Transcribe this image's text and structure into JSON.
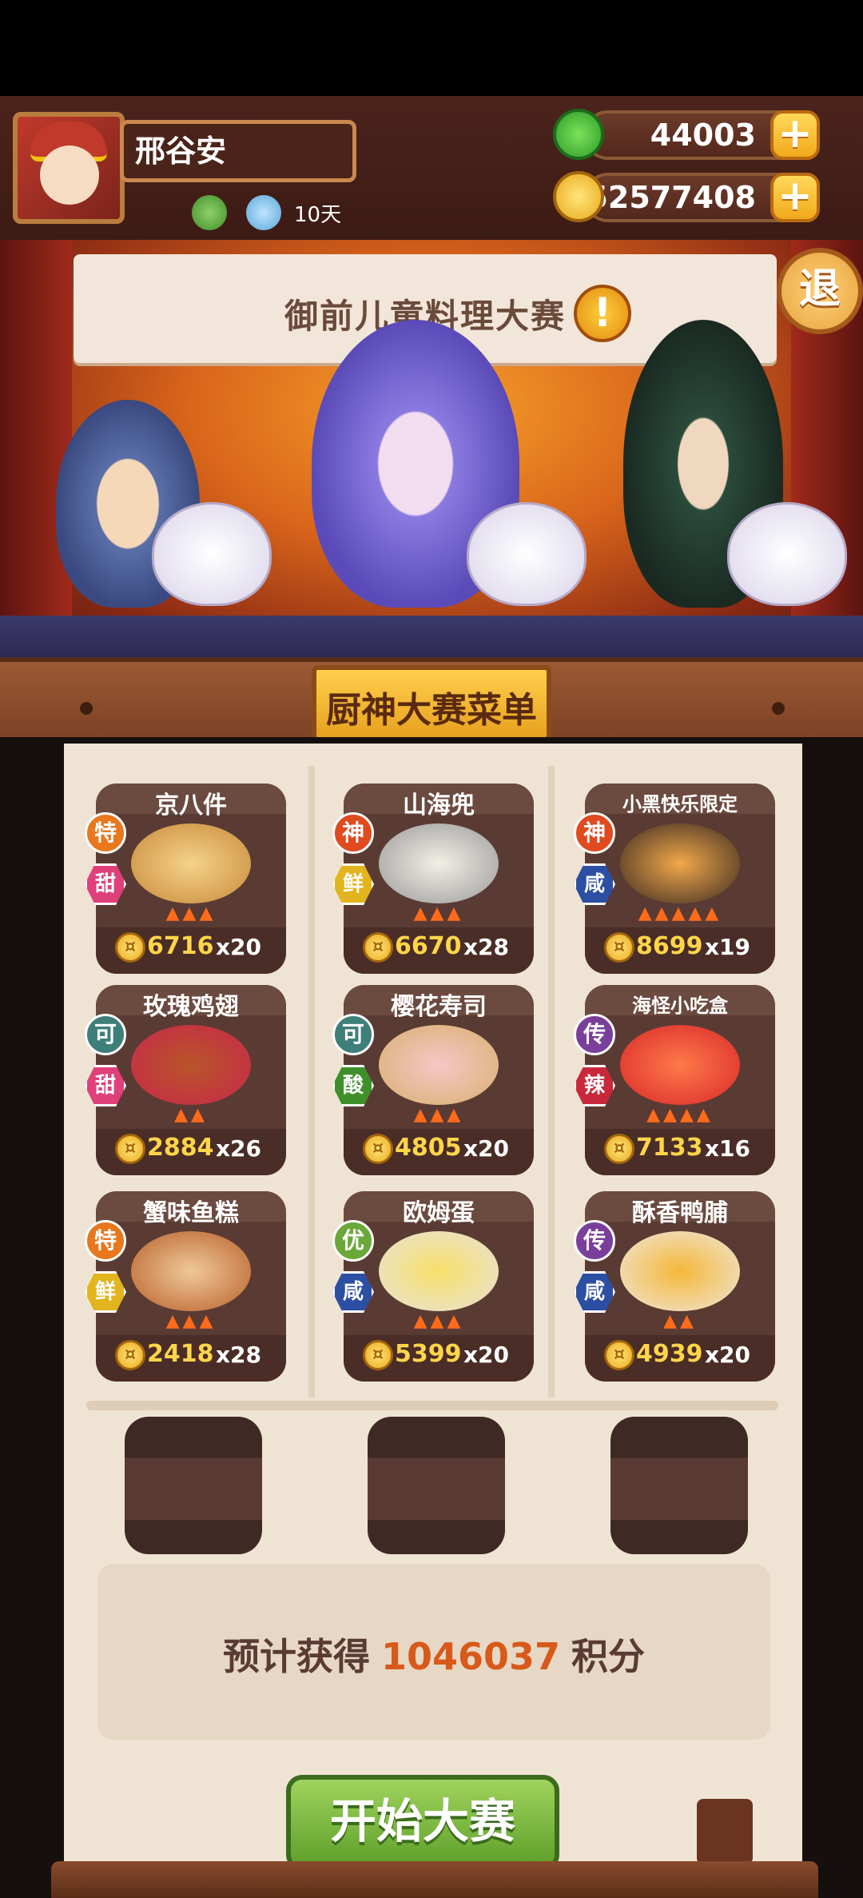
{
  "player": {
    "name": "邢谷安",
    "days": "10天"
  },
  "currency": {
    "jade": "44003",
    "coins": "52577408",
    "plus": "+"
  },
  "event": {
    "banner_title": "御前儿童料理大赛",
    "alert": "!",
    "exit_label": "退"
  },
  "menu": {
    "title": "厨神大赛菜单",
    "coin_glyph": "¤",
    "dishes": [
      {
        "name": "京八件",
        "rank": "特",
        "taste": "甜",
        "price": "6716",
        "qty": "x20",
        "rank_color": "#e8771e",
        "taste_color": "#e0407a"
      },
      {
        "name": "山海兜",
        "rank": "神",
        "taste": "鲜",
        "price": "6670",
        "qty": "x28",
        "rank_color": "#e04a1e",
        "taste_color": "#e2b41e"
      },
      {
        "name": "小黑快乐限定",
        "rank": "神",
        "taste": "咸",
        "price": "8699",
        "qty": "x19",
        "rank_color": "#e04a1e",
        "taste_color": "#2c4fa3"
      },
      {
        "name": "玫瑰鸡翅",
        "rank": "可",
        "taste": "甜",
        "price": "2884",
        "qty": "x26",
        "rank_color": "#3f7f7a",
        "taste_color": "#e0407a"
      },
      {
        "name": "樱花寿司",
        "rank": "可",
        "taste": "酸",
        "price": "4805",
        "qty": "x20",
        "rank_color": "#3f7f7a",
        "taste_color": "#3f8f2a"
      },
      {
        "name": "海怪小吃盒",
        "rank": "传",
        "taste": "辣",
        "price": "7133",
        "qty": "x16",
        "rank_color": "#7a3f9a",
        "taste_color": "#c8283a"
      },
      {
        "name": "蟹味鱼糕",
        "rank": "特",
        "taste": "鲜",
        "price": "2418",
        "qty": "x28",
        "rank_color": "#e8771e",
        "taste_color": "#e2b41e"
      },
      {
        "name": "欧姆蛋",
        "rank": "优",
        "taste": "咸",
        "price": "5399",
        "qty": "x20",
        "rank_color": "#6aa83a",
        "taste_color": "#2c4fa3"
      },
      {
        "name": "酥香鸭脯",
        "rank": "传",
        "taste": "咸",
        "price": "4939",
        "qty": "x20",
        "rank_color": "#7a3f9a",
        "taste_color": "#2c4fa3"
      }
    ]
  },
  "result": {
    "prefix": "预计获得",
    "points": "1046037",
    "suffix": "积分"
  },
  "start_button": "开始大赛"
}
